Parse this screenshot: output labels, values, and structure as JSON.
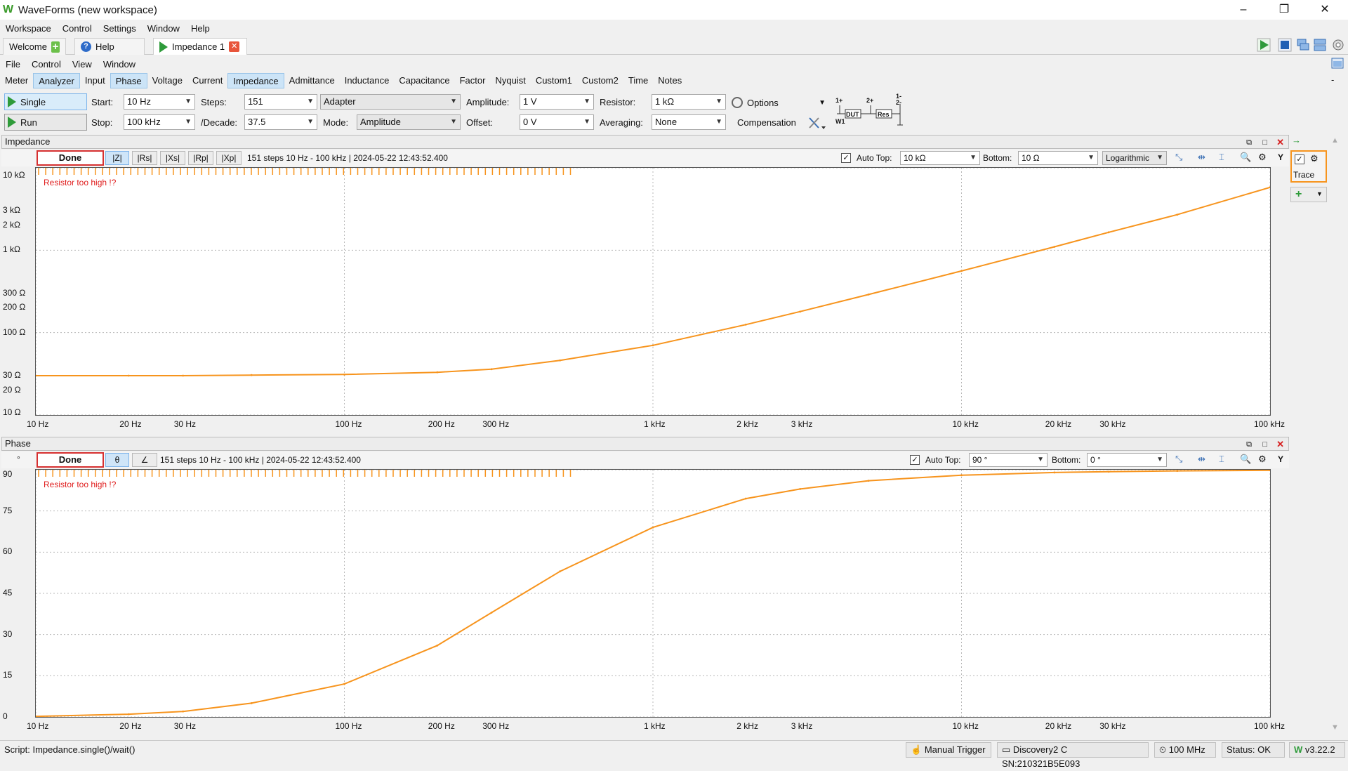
{
  "window": {
    "title": "WaveForms (new workspace)"
  },
  "app_menu": [
    "Workspace",
    "Control",
    "Settings",
    "Window",
    "Help"
  ],
  "doc_tabs": [
    {
      "label": "Welcome"
    },
    {
      "label": "Help"
    },
    {
      "label": "Impedance 1"
    }
  ],
  "inst_menu": [
    "File",
    "Control",
    "View",
    "Window"
  ],
  "inst_tabs": [
    "Meter",
    "Analyzer",
    "Input",
    "Phase",
    "Voltage",
    "Current",
    "Impedance",
    "Admittance",
    "Inductance",
    "Capacitance",
    "Factor",
    "Nyquist",
    "Custom1",
    "Custom2",
    "Time",
    "Notes"
  ],
  "controls": {
    "single": "Single",
    "run": "Run",
    "start_label": "Start:",
    "start_value": "10 Hz",
    "stop_label": "Stop:",
    "stop_value": "100 kHz",
    "steps_label": "Steps:",
    "steps_value": "151",
    "decade_label": "/Decade:",
    "decade_value": "37.5",
    "adapter_value": "Adapter",
    "mode_label": "Mode:",
    "mode_value": "Amplitude",
    "amplitude_label": "Amplitude:",
    "amplitude_value": "1 V",
    "offset_label": "Offset:",
    "offset_value": "0 V",
    "resistor_label": "Resistor:",
    "resistor_value": "1 kΩ",
    "averaging_label": "Averaging:",
    "averaging_value": "None",
    "options": "Options",
    "compensation": "Compensation",
    "circuit": {
      "w1p": "1+",
      "p2": "2+",
      "m1": "1-",
      "m2": "2-",
      "dut": "DUT",
      "res": "Res",
      "w1": "W1"
    }
  },
  "impedance": {
    "title": "Impedance",
    "status": "Done",
    "buttons": [
      "|Z|",
      "|Rs|",
      "|Xs|",
      "|Rp|",
      "|Xp|"
    ],
    "info": "151 steps 10 Hz - 100 kHz | 2024-05-22 12:43:52.400",
    "auto_top_label": "Auto Top:",
    "auto_top_value": "10 kΩ",
    "bottom_label": "Bottom:",
    "bottom_value": "10 Ω",
    "scale": "Logarithmic",
    "y_button": "Y",
    "warning": "Resistor too high !?",
    "y_ticks": [
      "10 kΩ",
      "3 kΩ",
      "2 kΩ",
      "1 kΩ",
      "300 Ω",
      "200 Ω",
      "100 Ω",
      "30 Ω",
      "20 Ω",
      "10 Ω"
    ]
  },
  "phase": {
    "title": "Phase",
    "status": "Done",
    "buttons": [
      "θ",
      "∠"
    ],
    "info": "151 steps 10 Hz - 100 kHz | 2024-05-22 12:43:52.400",
    "auto_top_label": "Auto Top:",
    "auto_top_value": "90 °",
    "bottom_label": "Bottom:",
    "bottom_value": "0 °",
    "y_button": "Y",
    "warning": "Resistor too high !?",
    "unit": "°",
    "y_ticks": [
      "90",
      "75",
      "60",
      "45",
      "30",
      "15",
      "0"
    ]
  },
  "x_ticks": [
    "10 Hz",
    "20 Hz",
    "30 Hz",
    "100 Hz",
    "200 Hz",
    "300 Hz",
    "1 kHz",
    "2 kHz",
    "3 kHz",
    "10 kHz",
    "20 kHz",
    "30 kHz",
    "100 kHz"
  ],
  "side": {
    "trace_label": "Trace"
  },
  "statusbar": {
    "script": "Script: Impedance.single()/wait()",
    "manual_trigger": "Manual Trigger",
    "device": "Discovery2 C SN:210321B5E093",
    "clock": "100 MHz",
    "status": "Status: OK",
    "version": "v3.22.2"
  },
  "chart_data": [
    {
      "type": "line",
      "title": "Impedance",
      "x_scale": "log",
      "y_scale": "log",
      "xlim": [
        10,
        100000
      ],
      "ylim": [
        10,
        10000
      ],
      "series": [
        {
          "color": "#f7941d",
          "x": [
            10,
            20,
            30,
            50,
            100,
            200,
            300,
            500,
            1000,
            2000,
            3000,
            5000,
            10000,
            20000,
            30000,
            50000,
            100000
          ],
          "y": [
            30,
            30,
            30,
            30.5,
            31,
            33,
            36,
            46,
            70,
            125,
            180,
            290,
            560,
            1100,
            1650,
            2700,
            5800
          ]
        }
      ]
    },
    {
      "type": "line",
      "title": "Phase",
      "x_scale": "log",
      "xlim": [
        10,
        100000
      ],
      "ylim": [
        0,
        90
      ],
      "series": [
        {
          "color": "#f7941d",
          "x": [
            10,
            20,
            30,
            50,
            100,
            200,
            300,
            500,
            1000,
            2000,
            3000,
            5000,
            10000,
            20000,
            30000,
            50000,
            100000
          ],
          "y": [
            0.2,
            1.0,
            2.0,
            5.0,
            12.0,
            26.0,
            38.0,
            53.0,
            69.0,
            79.5,
            83.0,
            86.0,
            88.0,
            89.0,
            89.3,
            89.6,
            89.8
          ]
        }
      ]
    }
  ]
}
